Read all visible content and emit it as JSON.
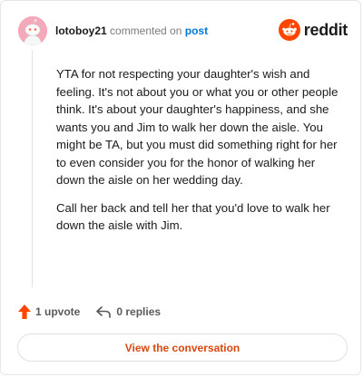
{
  "header": {
    "username": "lotoboy21",
    "commented_on": "commented on",
    "post_link": "post",
    "brand": "reddit"
  },
  "comment": {
    "paragraphs": [
      "YTA for not respecting your daughter's wish and feeling. It's not about you or what you or other people think. It's about your daughter's happiness, and she wants you and Jim to walk her down the aisle. You might be TA, but you must did something right for her to even consider you for the honor of walking her down the aisle on her wedding day.",
      "Call her back and tell her that you'd love to walk her down the aisle with Jim."
    ]
  },
  "footer": {
    "upvotes": "1 upvote",
    "replies": "0 replies",
    "cta": "View the conversation"
  },
  "colors": {
    "reddit_orange": "#ff4500",
    "cta_text": "#d9480f",
    "link_blue": "#0079d3",
    "avatar_bg": "#f4a9bb"
  },
  "icons": [
    "snoo-avatar-icon",
    "reddit-logo-icon",
    "upvote-arrow-icon",
    "reply-arrow-icon"
  ]
}
